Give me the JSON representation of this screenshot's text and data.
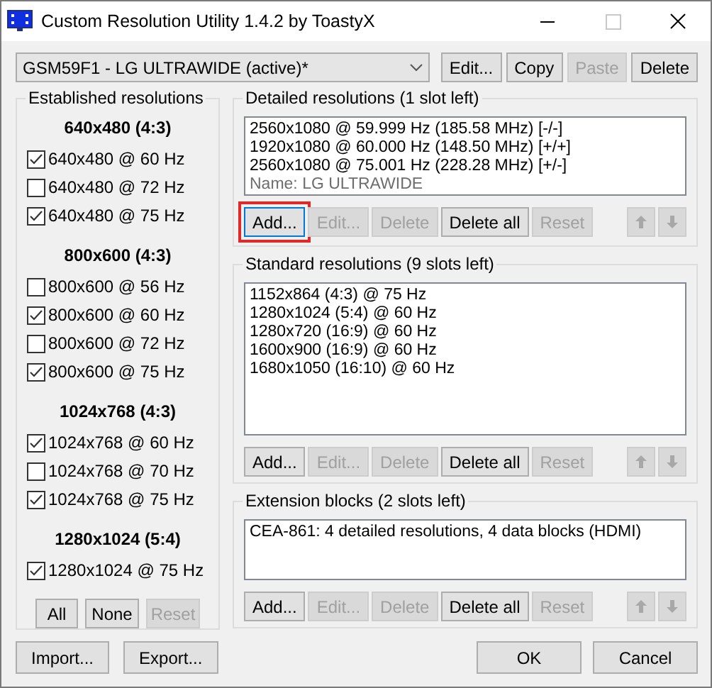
{
  "window": {
    "title": "Custom Resolution Utility 1.4.2 by ToastyX"
  },
  "monitor_select": {
    "value": "GSM59F1 - LG ULTRAWIDE (active)*"
  },
  "monitor_buttons": [
    {
      "label": "Edit...",
      "disabled": false
    },
    {
      "label": "Copy",
      "disabled": false
    },
    {
      "label": "Paste",
      "disabled": true
    },
    {
      "label": "Delete",
      "disabled": false
    }
  ],
  "established": {
    "title": "Established resolutions",
    "groups": [
      {
        "heading": "640x480 (4:3)",
        "items": [
          {
            "label": "640x480 @ 60 Hz",
            "checked": true
          },
          {
            "label": "640x480 @ 72 Hz",
            "checked": false
          },
          {
            "label": "640x480 @ 75 Hz",
            "checked": true
          }
        ]
      },
      {
        "heading": "800x600 (4:3)",
        "items": [
          {
            "label": "800x600 @ 56 Hz",
            "checked": false
          },
          {
            "label": "800x600 @ 60 Hz",
            "checked": true
          },
          {
            "label": "800x600 @ 72 Hz",
            "checked": false
          },
          {
            "label": "800x600 @ 75 Hz",
            "checked": true
          }
        ]
      },
      {
        "heading": "1024x768 (4:3)",
        "items": [
          {
            "label": "1024x768 @ 60 Hz",
            "checked": true
          },
          {
            "label": "1024x768 @ 70 Hz",
            "checked": false
          },
          {
            "label": "1024x768 @ 75 Hz",
            "checked": true
          }
        ]
      },
      {
        "heading": "1280x1024 (5:4)",
        "items": [
          {
            "label": "1280x1024 @ 75 Hz",
            "checked": true
          }
        ]
      }
    ],
    "buttons": [
      {
        "label": "All",
        "disabled": false
      },
      {
        "label": "None",
        "disabled": false
      },
      {
        "label": "Reset",
        "disabled": true
      }
    ]
  },
  "sections": [
    {
      "title": "Detailed resolutions (1 slot left)",
      "entries": [
        {
          "text": "2560x1080 @ 59.999 Hz (185.58 MHz) [-/-]",
          "kind": "mode"
        },
        {
          "text": "1920x1080 @ 60.000 Hz (148.50 MHz) [+/+]",
          "kind": "mode"
        },
        {
          "text": "2560x1080 @ 75.001 Hz (228.28 MHz) [+/-]",
          "kind": "mode"
        },
        {
          "text": "Name: LG ULTRAWIDE",
          "kind": "name"
        }
      ],
      "buttons": [
        {
          "label": "Add...",
          "disabled": false,
          "highlighted": true
        },
        {
          "label": "Edit...",
          "disabled": true,
          "highlighted": false
        },
        {
          "label": "Delete",
          "disabled": true,
          "highlighted": false
        },
        {
          "label": "Delete all",
          "disabled": false,
          "highlighted": false
        },
        {
          "label": "Reset",
          "disabled": true,
          "highlighted": false
        }
      ],
      "move_buttons": [
        {
          "kind": "up",
          "disabled": true
        },
        {
          "kind": "down",
          "disabled": true
        }
      ]
    },
    {
      "title": "Standard resolutions (9 slots left)",
      "entries": [
        {
          "text": "1152x864 (4:3) @ 75 Hz",
          "kind": "mode"
        },
        {
          "text": "1280x1024 (5:4) @ 60 Hz",
          "kind": "mode"
        },
        {
          "text": "1280x720 (16:9) @ 60 Hz",
          "kind": "mode"
        },
        {
          "text": "1600x900 (16:9) @ 60 Hz",
          "kind": "mode"
        },
        {
          "text": "1680x1050 (16:10) @ 60 Hz",
          "kind": "mode"
        }
      ],
      "buttons": [
        {
          "label": "Add...",
          "disabled": false,
          "highlighted": false
        },
        {
          "label": "Edit...",
          "disabled": true,
          "highlighted": false
        },
        {
          "label": "Delete",
          "disabled": true,
          "highlighted": false
        },
        {
          "label": "Delete all",
          "disabled": false,
          "highlighted": false
        },
        {
          "label": "Reset",
          "disabled": true,
          "highlighted": false
        }
      ],
      "move_buttons": [
        {
          "kind": "up",
          "disabled": true
        },
        {
          "kind": "down",
          "disabled": true
        }
      ]
    },
    {
      "title": "Extension blocks (2 slots left)",
      "entries": [
        {
          "text": "CEA-861: 4 detailed resolutions, 4 data blocks (HDMI)",
          "kind": "mode"
        }
      ],
      "buttons": [
        {
          "label": "Add...",
          "disabled": false,
          "highlighted": false
        },
        {
          "label": "Edit...",
          "disabled": true,
          "highlighted": false
        },
        {
          "label": "Delete",
          "disabled": true,
          "highlighted": false
        },
        {
          "label": "Delete all",
          "disabled": false,
          "highlighted": false
        },
        {
          "label": "Reset",
          "disabled": true,
          "highlighted": false
        }
      ],
      "move_buttons": [
        {
          "kind": "up",
          "disabled": true
        },
        {
          "kind": "down",
          "disabled": true
        }
      ]
    }
  ],
  "footer_left": [
    {
      "label": "Import...",
      "disabled": false
    },
    {
      "label": "Export...",
      "disabled": false
    }
  ],
  "footer_right": [
    {
      "label": "OK",
      "disabled": false
    },
    {
      "label": "Cancel",
      "disabled": false
    }
  ]
}
